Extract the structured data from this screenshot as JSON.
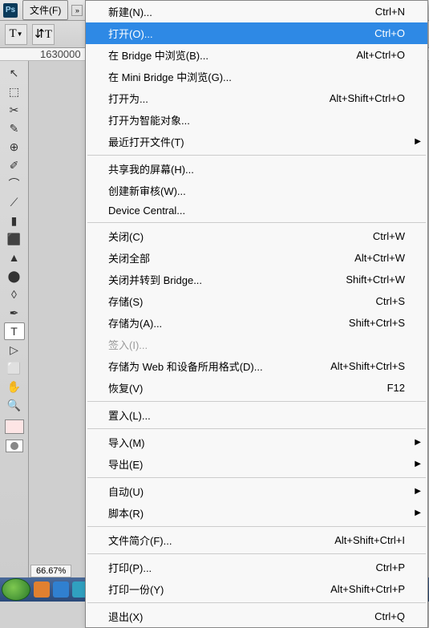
{
  "titlebar": {
    "ps": "Ps",
    "file_menu": "文件(F)"
  },
  "ruler": {
    "mark": "1630000"
  },
  "zoom": "66.67%",
  "tools": [
    "↖",
    "⬚",
    "✂",
    "✎",
    "⊕",
    "✐",
    "⌒",
    "⟋",
    "▮",
    "⬛",
    "▲",
    "⬤",
    "◊",
    "✒",
    "T",
    "▷",
    "⬜",
    "✋",
    "🔍"
  ],
  "menu": [
    {
      "type": "item",
      "label": "新建(N)...",
      "shortcut": "Ctrl+N"
    },
    {
      "type": "item",
      "label": "打开(O)...",
      "shortcut": "Ctrl+O",
      "highlighted": true
    },
    {
      "type": "item",
      "label": "在 Bridge 中浏览(B)...",
      "shortcut": "Alt+Ctrl+O"
    },
    {
      "type": "item",
      "label": "在 Mini Bridge 中浏览(G)..."
    },
    {
      "type": "item",
      "label": "打开为...",
      "shortcut": "Alt+Shift+Ctrl+O"
    },
    {
      "type": "item",
      "label": "打开为智能对象..."
    },
    {
      "type": "item",
      "label": "最近打开文件(T)",
      "submenu": true
    },
    {
      "type": "sep"
    },
    {
      "type": "item",
      "label": "共享我的屏幕(H)..."
    },
    {
      "type": "item",
      "label": "创建新审核(W)..."
    },
    {
      "type": "item",
      "label": "Device Central..."
    },
    {
      "type": "sep"
    },
    {
      "type": "item",
      "label": "关闭(C)",
      "shortcut": "Ctrl+W"
    },
    {
      "type": "item",
      "label": "关闭全部",
      "shortcut": "Alt+Ctrl+W"
    },
    {
      "type": "item",
      "label": "关闭并转到 Bridge...",
      "shortcut": "Shift+Ctrl+W"
    },
    {
      "type": "item",
      "label": "存储(S)",
      "shortcut": "Ctrl+S"
    },
    {
      "type": "item",
      "label": "存储为(A)...",
      "shortcut": "Shift+Ctrl+S"
    },
    {
      "type": "item",
      "label": "签入(I)...",
      "disabled": true
    },
    {
      "type": "item",
      "label": "存储为 Web 和设备所用格式(D)...",
      "shortcut": "Alt+Shift+Ctrl+S"
    },
    {
      "type": "item",
      "label": "恢复(V)",
      "shortcut": "F12"
    },
    {
      "type": "sep"
    },
    {
      "type": "item",
      "label": "置入(L)..."
    },
    {
      "type": "sep"
    },
    {
      "type": "item",
      "label": "导入(M)",
      "submenu": true
    },
    {
      "type": "item",
      "label": "导出(E)",
      "submenu": true
    },
    {
      "type": "sep"
    },
    {
      "type": "item",
      "label": "自动(U)",
      "submenu": true
    },
    {
      "type": "item",
      "label": "脚本(R)",
      "submenu": true
    },
    {
      "type": "sep"
    },
    {
      "type": "item",
      "label": "文件简介(F)...",
      "shortcut": "Alt+Shift+Ctrl+I"
    },
    {
      "type": "sep"
    },
    {
      "type": "item",
      "label": "打印(P)...",
      "shortcut": "Ctrl+P"
    },
    {
      "type": "item",
      "label": "打印一份(Y)",
      "shortcut": "Alt+Shift+Ctrl+P"
    },
    {
      "type": "sep"
    },
    {
      "type": "item",
      "label": "退出(X)",
      "shortcut": "Ctrl+Q"
    }
  ]
}
